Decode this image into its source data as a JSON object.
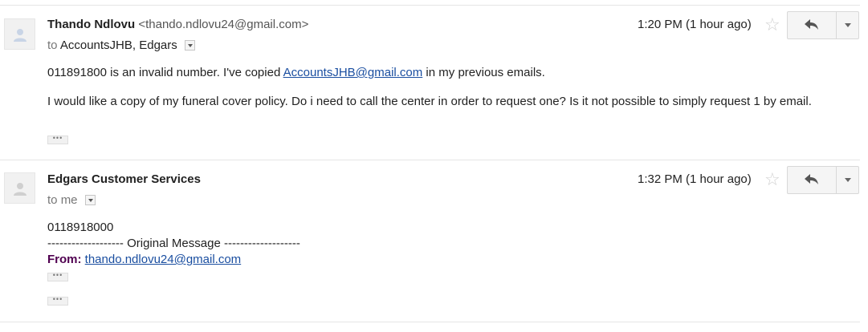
{
  "messages": [
    {
      "sender_name": "Thando Ndlovu",
      "sender_email": "<thando.ndlovu24@gmail.com>",
      "to_prefix": "to",
      "to_names": "AccountsJHB, Edgars",
      "time": "1:20 PM (1 hour ago)",
      "body_p1_before": "011891800 is an invalid number. I've copied ",
      "body_p1_link": "AccountsJHB@gmail.com",
      "body_p1_after": " in my previous emails.",
      "body_p2": "I would like a copy of my funeral cover policy. Do i need to call the center in order to request one? Is it not possible to simply request 1 by email.",
      "ellipsis": "•••"
    },
    {
      "sender_name": "Edgars Customer Services",
      "to_prefix": "to",
      "to_names": "me",
      "time": "1:32 PM (1 hour ago)",
      "body_line1": "0118918000",
      "original_message": "------------------- Original Message -------------------",
      "from_label": "From:",
      "from_email": "thando.ndlovu24@gmail.com",
      "ellipsis": "•••"
    }
  ],
  "icons": {
    "avatar": "person-icon",
    "star": "star-icon",
    "reply": "reply-icon",
    "more": "chevron-down-icon"
  },
  "colors": {
    "link": "#1a4ea0",
    "from_label": "#500050",
    "divider": "#e5e5e5"
  }
}
